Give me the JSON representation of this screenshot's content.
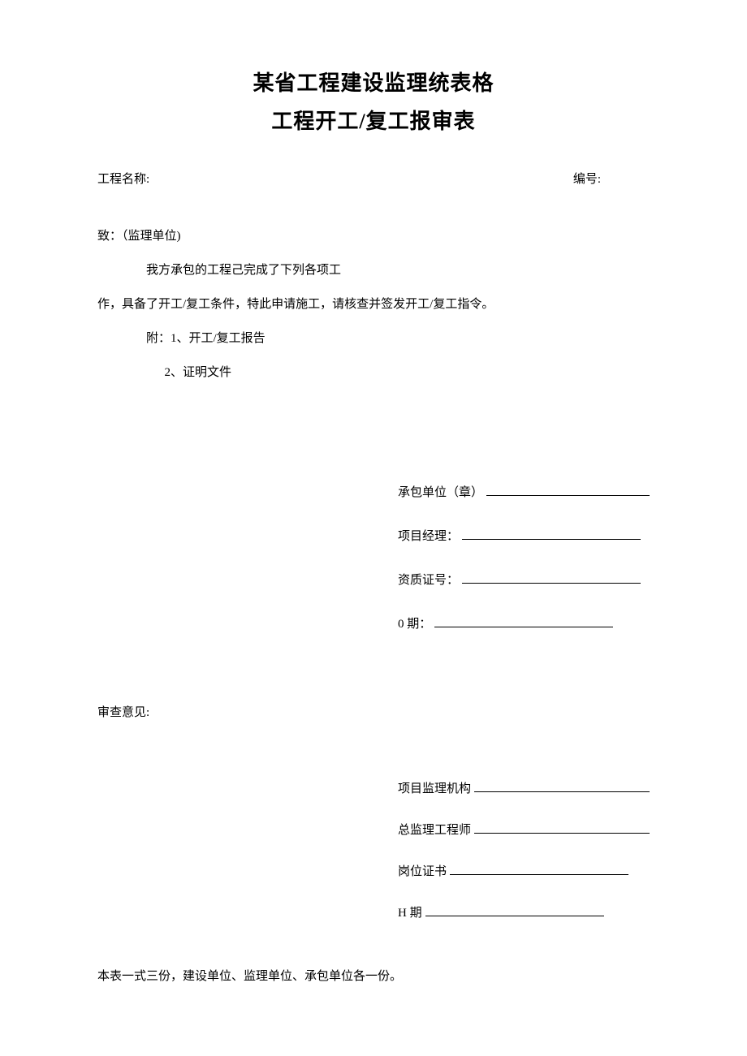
{
  "title": {
    "line1": "某省工程建设监理统表格",
    "line2": "工程开工/复工报审表"
  },
  "meta": {
    "project_name_label": "工程名称:",
    "serial_label": "编号:"
  },
  "body": {
    "to_line": "致：（监理单位)",
    "para1": "我方承包的工程己完成了下列各项工",
    "para2": "作，具备了开工/复工条件，特此申请施工，请核查并签发开工/复工指令。",
    "attach_label": "附：1、开工/复工报告",
    "attach_2": "2、证明文件"
  },
  "signatures1": {
    "contractor_label": "承包单位（章）",
    "pm_label": "项目经理：",
    "cert_label": "资质证号：",
    "date_label": "0 期："
  },
  "review": {
    "label": "审查意见:"
  },
  "signatures2": {
    "supervisor_org_label": "项目监理机构",
    "chief_engineer_label": "总监理工程师",
    "post_cert_label": "岗位证书",
    "date_label": "H 期"
  },
  "footer": {
    "note": "本表一式三份，建设单位、监理单位、承包单位各一份。"
  }
}
